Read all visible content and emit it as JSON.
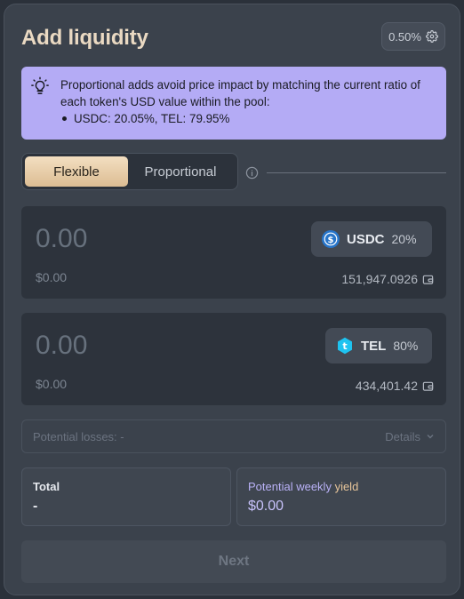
{
  "header": {
    "title": "Add liquidity",
    "slippage": "0.50%"
  },
  "info": {
    "text": "Proportional adds avoid price impact by matching the current ratio of each token's USD value within the pool:",
    "bullet": "USDC: 20.05%, TEL: 79.95%"
  },
  "mode_toggle": {
    "options": [
      "Flexible",
      "Proportional"
    ],
    "selected": "Flexible"
  },
  "tokens": [
    {
      "amount_placeholder": "0.00",
      "usd_value": "$0.00",
      "symbol": "USDC",
      "weight": "20%",
      "balance": "151,947.0926",
      "icon": "usdc-icon",
      "color": "#2775ca"
    },
    {
      "amount_placeholder": "0.00",
      "usd_value": "$0.00",
      "symbol": "TEL",
      "weight": "80%",
      "balance": "434,401.42",
      "icon": "tel-icon",
      "color": "#1ec3f0"
    }
  ],
  "losses": {
    "label": "Potential losses: -",
    "details_label": "Details"
  },
  "stats": {
    "total_label": "Total",
    "total_value": "-",
    "yield_label_prefix": "Potential weekly ",
    "yield_label_accent": "yield",
    "yield_value": "$0.00"
  },
  "actions": {
    "next_label": "Next"
  },
  "colors": {
    "panel": "#3b424c",
    "info_bg": "#b4abf5",
    "accent_gold": "#ead9c2"
  }
}
